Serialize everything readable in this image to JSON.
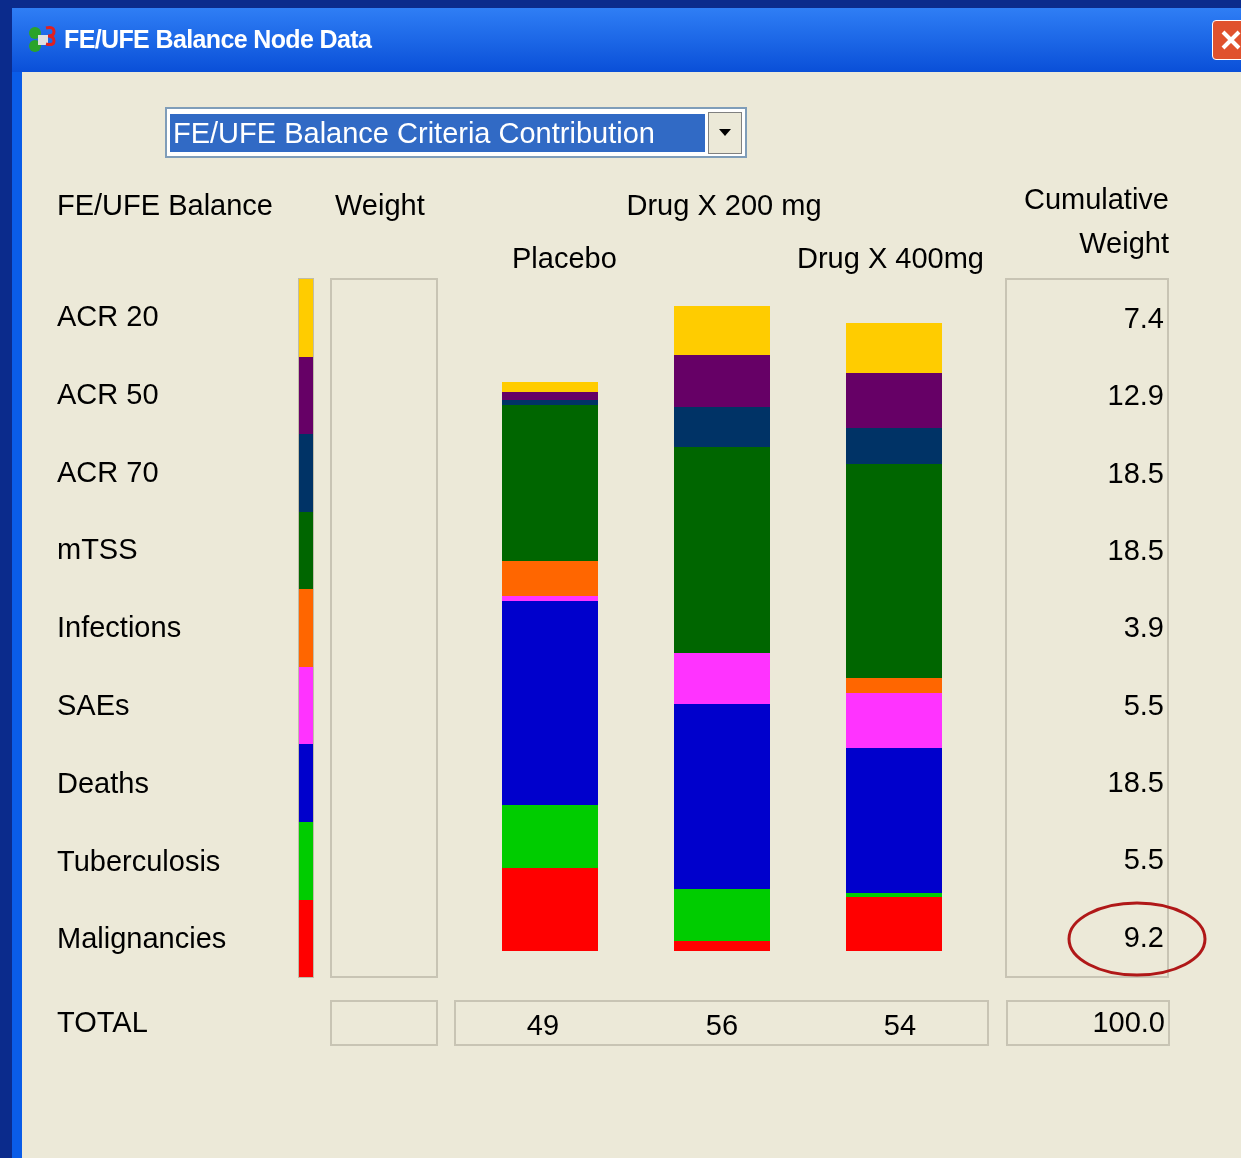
{
  "window": {
    "title": "FE/UFE Balance Node Data"
  },
  "dropdown": {
    "value": "FE/UFE Balance Criteria Contribution"
  },
  "headers": {
    "criteria": "FE/UFE Balance",
    "weight": "Weight",
    "treatments": [
      "Drug X 200 mg",
      "Placebo",
      "Drug X 400mg"
    ],
    "cumulative": "Cumulative Weight"
  },
  "criteria": [
    {
      "name": "ACR 20",
      "color": "#ffcc00",
      "cumulative_weight": "7.4",
      "circled": false
    },
    {
      "name": "ACR 50",
      "color": "#660066",
      "cumulative_weight": "12.9",
      "circled": false
    },
    {
      "name": "ACR 70",
      "color": "#003366",
      "cumulative_weight": "18.5",
      "circled": false
    },
    {
      "name": "mTSS",
      "color": "#006600",
      "cumulative_weight": "18.5",
      "circled": false
    },
    {
      "name": "Infections",
      "color": "#ff6600",
      "cumulative_weight": "3.9",
      "circled": false
    },
    {
      "name": "SAEs",
      "color": "#ff33ff",
      "cumulative_weight": "5.5",
      "circled": false
    },
    {
      "name": "Deaths",
      "color": "#0000cc",
      "cumulative_weight": "18.5",
      "circled": false
    },
    {
      "name": "Tuberculosis",
      "color": "#00cc00",
      "cumulative_weight": "5.5",
      "circled": false
    },
    {
      "name": "Malignancies",
      "color": "#ff0000",
      "cumulative_weight": "9.2",
      "circled": true
    }
  ],
  "total": {
    "label": "TOTAL",
    "values": [
      "49",
      "56",
      "54"
    ],
    "cumulative": "100.0"
  }
}
